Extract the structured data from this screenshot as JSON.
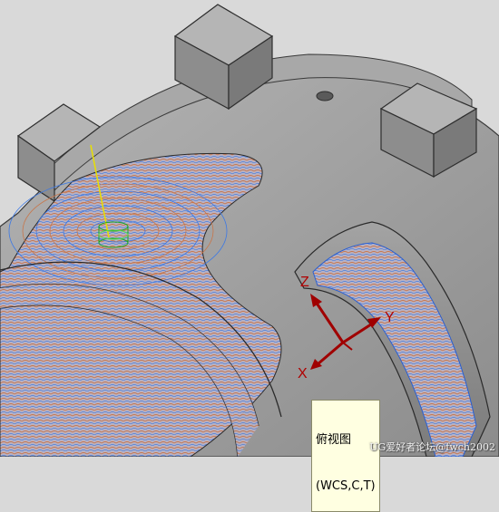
{
  "view": {
    "tooltip_line1": "俯视图",
    "tooltip_line2": "(WCS,C,T)"
  },
  "triad": {
    "x_label": "X",
    "y_label": "Y",
    "z_label": "Z"
  },
  "watermark": "UG爱好者论坛@fwch2002",
  "colors": {
    "background": "#d9d9d9",
    "part_gray": "#9a9a9a",
    "toolpath_blue": "#2f6fe8",
    "toolpath_orange": "#c8764a",
    "axis_red": "#a00000",
    "tool_green": "#2fbf2f",
    "tool_axis_yellow": "#e8e000"
  }
}
